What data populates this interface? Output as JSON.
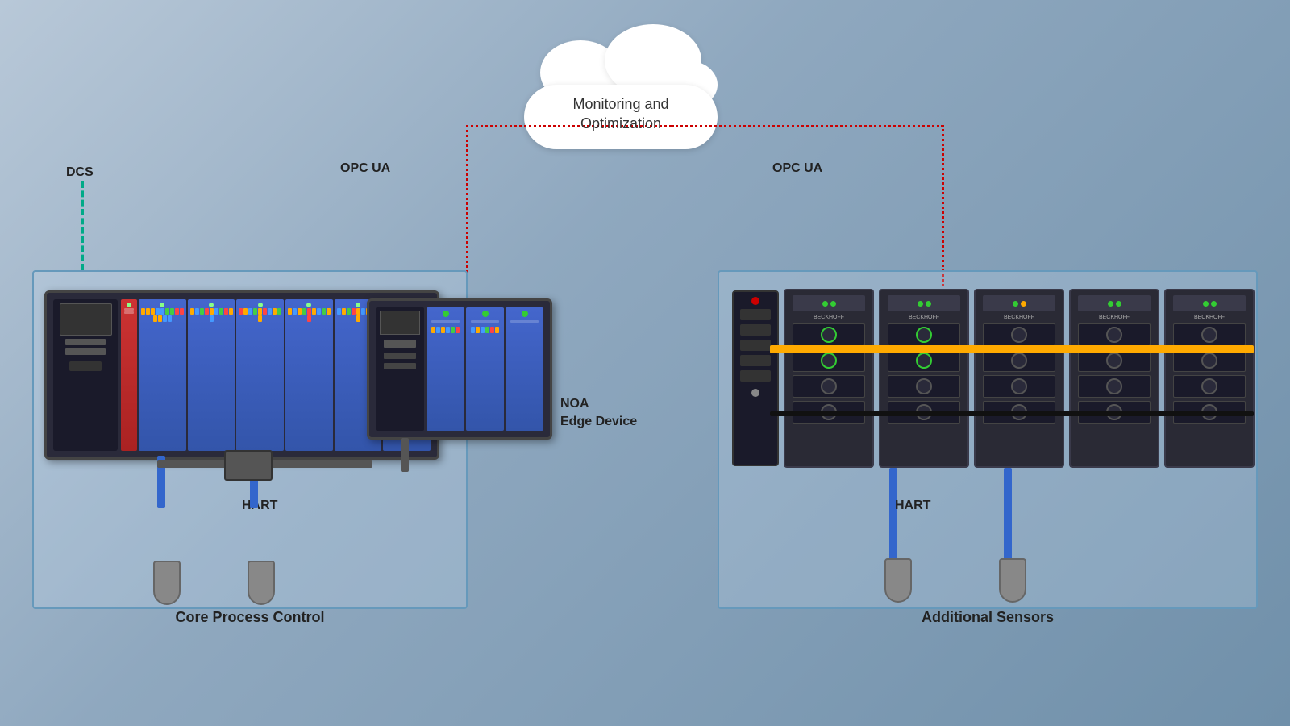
{
  "cloud": {
    "line1": "Monitoring and",
    "line2": "Optimization"
  },
  "labels": {
    "dcs": "DCS",
    "opc_ua_left": "OPC UA",
    "opc_ua_right": "OPC UA",
    "noa_edge": "NOA\nEdge Device",
    "noa_line1": "NOA",
    "noa_line2": "Edge Device",
    "hart_left": "HART",
    "hart_right": "HART",
    "core_process": "Core Process Control",
    "additional_sensors": "Additional Sensors"
  },
  "colors": {
    "background_start": "#b8c8d8",
    "background_end": "#7090aa",
    "dotted_line": "#cc0000",
    "dcs_line": "#00aa88",
    "cable_blue": "#3366cc",
    "bus_yellow": "#ffaa00",
    "bus_black": "#111111",
    "box_border": "#6699bb"
  }
}
